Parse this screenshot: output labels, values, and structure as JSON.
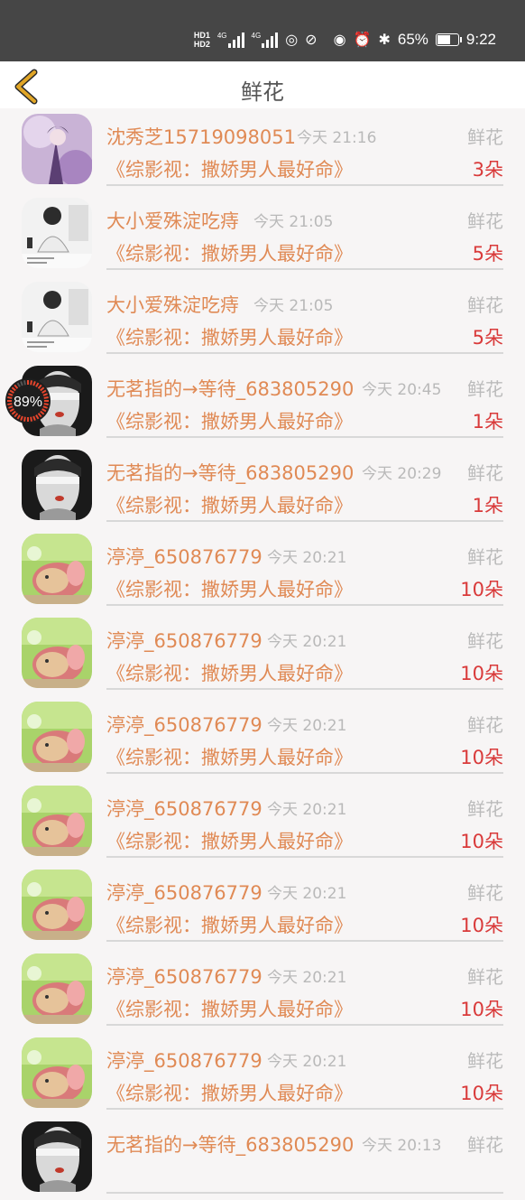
{
  "status_bar": {
    "hd1": "HD1",
    "hd2": "HD2",
    "net1": "4G",
    "net2": "4G",
    "battery_percent": "65%",
    "battery_level": 0.65,
    "time": "9:22",
    "icons": [
      "signal-icon",
      "signal-icon",
      "nfc-icon",
      "alarm-icon",
      "eye-icon",
      "clock-icon",
      "bluetooth-icon",
      "battery-icon"
    ]
  },
  "header": {
    "title": "鲜花",
    "back_icon": "chevron-left-icon"
  },
  "overlay": {
    "progress_text": "89%",
    "progress_value": 0.89
  },
  "rows": [
    {
      "name": "沈秀芝15719098051",
      "time": "今天 21:16",
      "gift": "鲜花",
      "book": "《综影视：撒娇男人最好命》",
      "count": "3朵",
      "avatar": "portrait-purple"
    },
    {
      "name": "大小爱殊淀吃痔",
      "time": "今天 21:05",
      "gift": "鲜花",
      "book": "《综影视：撒娇男人最好命》",
      "count": "5朵",
      "avatar": "portrait-room"
    },
    {
      "name": "大小爱殊淀吃痔",
      "time": "今天 21:05",
      "gift": "鲜花",
      "book": "《综影视：撒娇男人最好命》",
      "count": "5朵",
      "avatar": "portrait-room"
    },
    {
      "name": "无茗指的→等待_683805290",
      "time": "今天 20:45",
      "gift": "鲜花",
      "book": "《综影视：撒娇男人最好命》",
      "count": "1朵",
      "avatar": "portrait-blindfold"
    },
    {
      "name": "无茗指的→等待_683805290",
      "time": "今天 20:29",
      "gift": "鲜花",
      "book": "《综影视：撒娇男人最好命》",
      "count": "1朵",
      "avatar": "portrait-blindfold"
    },
    {
      "name": "渟渟_650876779",
      "time": "今天 20:21",
      "gift": "鲜花",
      "book": "《综影视：撒娇男人最好命》",
      "count": "10朵",
      "avatar": "hamster-green"
    },
    {
      "name": "渟渟_650876779",
      "time": "今天 20:21",
      "gift": "鲜花",
      "book": "《综影视：撒娇男人最好命》",
      "count": "10朵",
      "avatar": "hamster-green"
    },
    {
      "name": "渟渟_650876779",
      "time": "今天 20:21",
      "gift": "鲜花",
      "book": "《综影视：撒娇男人最好命》",
      "count": "10朵",
      "avatar": "hamster-green"
    },
    {
      "name": "渟渟_650876779",
      "time": "今天 20:21",
      "gift": "鲜花",
      "book": "《综影视：撒娇男人最好命》",
      "count": "10朵",
      "avatar": "hamster-green"
    },
    {
      "name": "渟渟_650876779",
      "time": "今天 20:21",
      "gift": "鲜花",
      "book": "《综影视：撒娇男人最好命》",
      "count": "10朵",
      "avatar": "hamster-green"
    },
    {
      "name": "渟渟_650876779",
      "time": "今天 20:21",
      "gift": "鲜花",
      "book": "《综影视：撒娇男人最好命》",
      "count": "10朵",
      "avatar": "hamster-green"
    },
    {
      "name": "渟渟_650876779",
      "time": "今天 20:21",
      "gift": "鲜花",
      "book": "《综影视：撒娇男人最好命》",
      "count": "10朵",
      "avatar": "hamster-green"
    },
    {
      "name": "无茗指的→等待_683805290",
      "time": "今天 20:13",
      "gift": "鲜花",
      "book": "",
      "count": "",
      "avatar": "portrait-blindfold"
    }
  ],
  "colors": {
    "status_bar_bg": "#464646",
    "accent_orange": "#e08a55",
    "count_red": "#d93a3a",
    "back_icon": "#e0a526"
  }
}
